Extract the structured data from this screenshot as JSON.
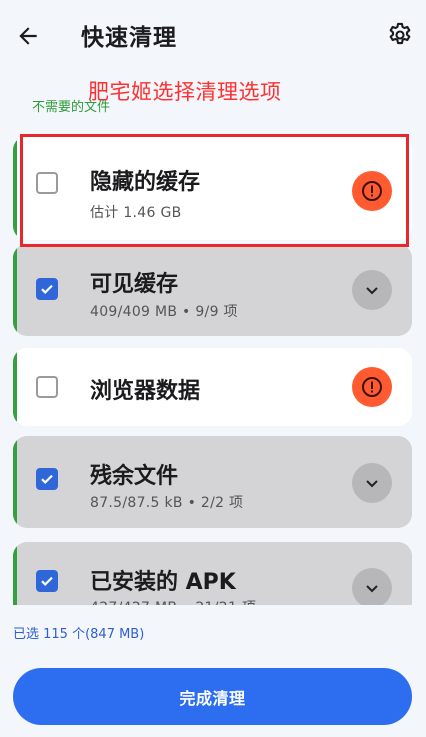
{
  "header": {
    "title": "快速清理",
    "back_icon": "arrow-left-icon",
    "settings_icon": "gear-icon"
  },
  "annotation": "肥宅姬选择清理选项",
  "section_label": "不需要的文件",
  "items": [
    {
      "title": "隐藏的缓存",
      "subtitle": "估计 1.46 GB",
      "checked": false,
      "action_icon": "alert-icon"
    },
    {
      "title": "可见缓存",
      "subtitle": "409/409 MB • 9/9 项",
      "checked": true,
      "action_icon": "chevron-down-icon"
    },
    {
      "title": "浏览器数据",
      "subtitle": "",
      "checked": false,
      "action_icon": "alert-icon"
    },
    {
      "title": "残余文件",
      "subtitle": "87.5/87.5 kB • 2/2 项",
      "checked": true,
      "action_icon": "chevron-down-icon"
    },
    {
      "title": "已安装的 APK",
      "subtitle": "427/427 MB • 21/21 项",
      "checked": true,
      "action_icon": "chevron-down-icon"
    }
  ],
  "footer": {
    "selected_summary": "已选 115 个(847 MB)",
    "finish_button": "完成清理"
  },
  "colors": {
    "accent": "#2d6df0",
    "checkbox_checked": "#2f67d8",
    "warning": "#ff5a30",
    "group_bar": "#35a040",
    "annotation": "#ff3030"
  }
}
